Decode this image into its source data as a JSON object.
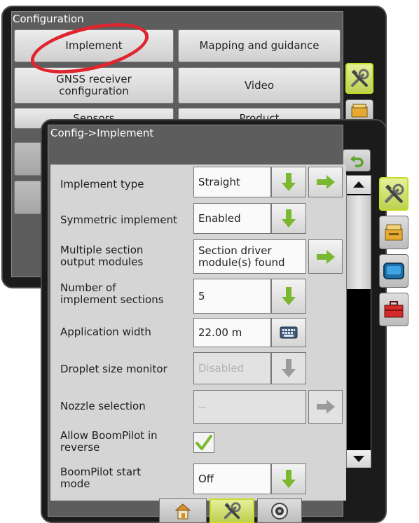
{
  "back_screen": {
    "title": "Configuration",
    "buttons": [
      {
        "label": "Implement"
      },
      {
        "label": "Mapping and guidance"
      },
      {
        "label": "GNSS receiver configuration"
      },
      {
        "label": "Video"
      },
      {
        "label": "Sensors"
      },
      {
        "label": "Product"
      }
    ]
  },
  "front_screen": {
    "title": "Config->Implement",
    "rows": [
      {
        "label": "Implement type",
        "value": "Straight"
      },
      {
        "label": "Symmetric implement",
        "value": "Enabled"
      },
      {
        "label": "Multiple section output modules",
        "value": "Section driver module(s) found"
      },
      {
        "label": "Number of implement sections",
        "value": "5"
      },
      {
        "label": "Application width",
        "value": "22.00 m"
      },
      {
        "label": "Droplet size monitor",
        "value": "Disabled"
      },
      {
        "label": "Nozzle selection",
        "value": "--"
      },
      {
        "label": "Allow BoomPilot in reverse",
        "checked": true
      },
      {
        "label": "BoomPilot start mode",
        "value": "Off"
      }
    ]
  },
  "icons": {
    "tools": "tools-icon",
    "back": "back-arrow-icon",
    "dropdown": "green-down-arrow-icon",
    "next": "green-right-arrow-icon",
    "keyboard": "keyboard-icon",
    "home": "home-icon",
    "camera": "camera-icon",
    "product": "product-bin-icon",
    "console": "console-icon",
    "toolbox": "toolbox-icon"
  },
  "colors": {
    "accent_green": "#7ab82f",
    "active_tab": "#c8dc28",
    "highlight": "#e0252f"
  }
}
